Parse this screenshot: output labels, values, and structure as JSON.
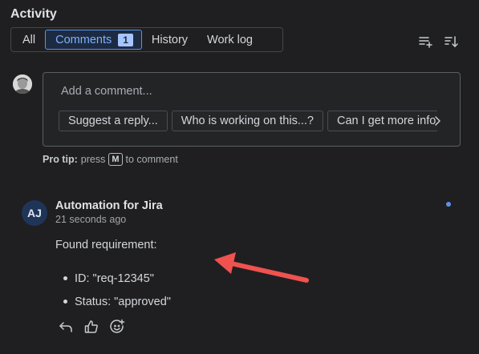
{
  "header": {
    "title": "Activity"
  },
  "tabs": [
    {
      "label": "All"
    },
    {
      "label": "Comments",
      "badge": "1",
      "active": true
    },
    {
      "label": "History"
    },
    {
      "label": "Work log"
    }
  ],
  "toolbar": {
    "icons": [
      "filter-list-add-icon",
      "sort-icon"
    ]
  },
  "composer": {
    "placeholder": "Add a comment...",
    "suggestions": [
      "Suggest a reply...",
      "Who is working on this...?",
      "Can I get more info...?"
    ]
  },
  "protip": {
    "label": "Pro tip:",
    "text_before": "press",
    "key": "M",
    "text_after": "to comment"
  },
  "comment": {
    "avatar_initials": "AJ",
    "author": "Automation for Jira",
    "time": "21 seconds ago",
    "body": "Found requirement:",
    "items": [
      "ID: \"req-12345\"",
      "Status: \"approved\""
    ],
    "actions": [
      "reply-icon",
      "thumbs-up-icon",
      "add-reaction-icon"
    ]
  },
  "colors": {
    "accent": "#5d93e6",
    "annotation_arrow": "#f0524f",
    "background": "#1f1f21"
  }
}
